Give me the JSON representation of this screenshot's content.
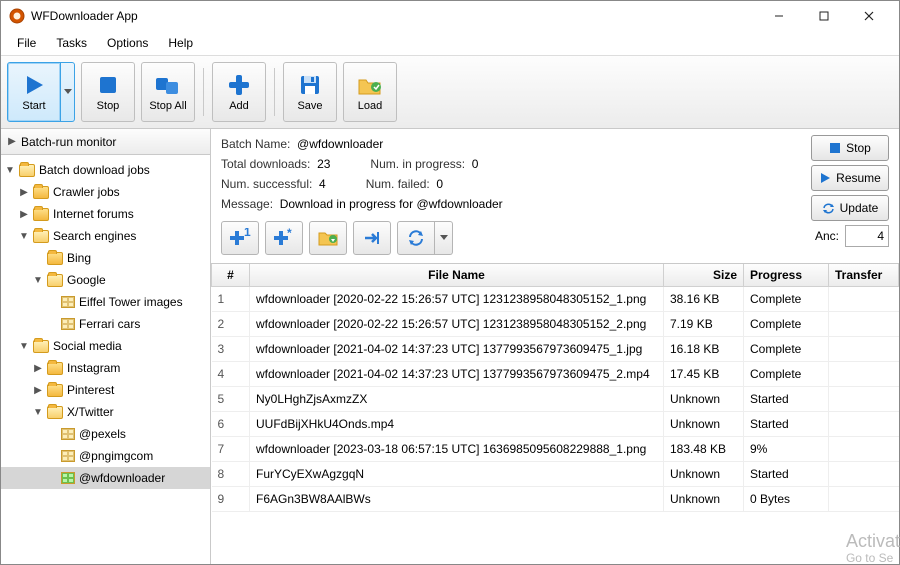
{
  "window": {
    "title": "WFDownloader App"
  },
  "menu": {
    "file": "File",
    "tasks": "Tasks",
    "options": "Options",
    "help": "Help"
  },
  "toolbar": {
    "start": "Start",
    "stop": "Stop",
    "stopall": "Stop All",
    "add": "Add",
    "save": "Save",
    "load": "Load"
  },
  "sidebar": {
    "header": "Batch-run monitor",
    "root": "Batch download jobs",
    "crawler": "Crawler jobs",
    "forums": "Internet forums",
    "search": "Search engines",
    "bing": "Bing",
    "google": "Google",
    "eiffel": "Eiffel Tower images",
    "ferrari": "Ferrari cars",
    "social": "Social media",
    "instagram": "Instagram",
    "pinterest": "Pinterest",
    "xtwitter": "X/Twitter",
    "pexels": "@pexels",
    "pngimg": "@pngimgcom",
    "wfd": "@wfdownloader"
  },
  "info": {
    "batch_label": "Batch Name:",
    "batch_value": "@wfdownloader",
    "total_label": "Total downloads:",
    "total_value": "23",
    "inprog_label": "Num. in progress:",
    "inprog_value": "0",
    "succ_label": "Num. successful:",
    "succ_value": "4",
    "fail_label": "Num. failed:",
    "fail_value": "0",
    "msg_label": "Message:",
    "msg_value": "Download in progress for @wfdownloader"
  },
  "rbuttons": {
    "stop": "Stop",
    "resume": "Resume",
    "update": "Update",
    "anc_label": "Anc:",
    "anc_value": "4"
  },
  "table": {
    "headers": {
      "num": "#",
      "file": "File Name",
      "size": "Size",
      "prog": "Progress",
      "xfer": "Transfer"
    },
    "rows": [
      {
        "n": "1",
        "f": "wfdownloader [2020-02-22 15:26:57 UTC] 1231238958048305152_1.png",
        "s": "38.16 KB",
        "p": "Complete"
      },
      {
        "n": "2",
        "f": "wfdownloader [2020-02-22 15:26:57 UTC] 1231238958048305152_2.png",
        "s": "7.19 KB",
        "p": "Complete"
      },
      {
        "n": "3",
        "f": "wfdownloader [2021-04-02 14:37:23 UTC] 1377993567973609475_1.jpg",
        "s": "16.18 KB",
        "p": "Complete"
      },
      {
        "n": "4",
        "f": "wfdownloader [2021-04-02 14:37:23 UTC] 1377993567973609475_2.mp4",
        "s": "17.45 KB",
        "p": "Complete"
      },
      {
        "n": "5",
        "f": "Ny0LHghZjsAxmzZX",
        "s": "Unknown",
        "p": "Started"
      },
      {
        "n": "6",
        "f": "UUFdBijXHkU4Onds.mp4",
        "s": "Unknown",
        "p": "Started"
      },
      {
        "n": "7",
        "f": "wfdownloader [2023-03-18 06:57:15 UTC] 1636985095608229888_1.png",
        "s": "183.48 KB",
        "p": "9%"
      },
      {
        "n": "8",
        "f": "FurYCyEXwAgzgqN",
        "s": "Unknown",
        "p": "Started"
      },
      {
        "n": "9",
        "f": "F6AGn3BW8AAlBWs",
        "s": "Unknown",
        "p": "0 Bytes"
      }
    ]
  },
  "watermark": {
    "big": "Activat",
    "small": "Go to Se"
  }
}
